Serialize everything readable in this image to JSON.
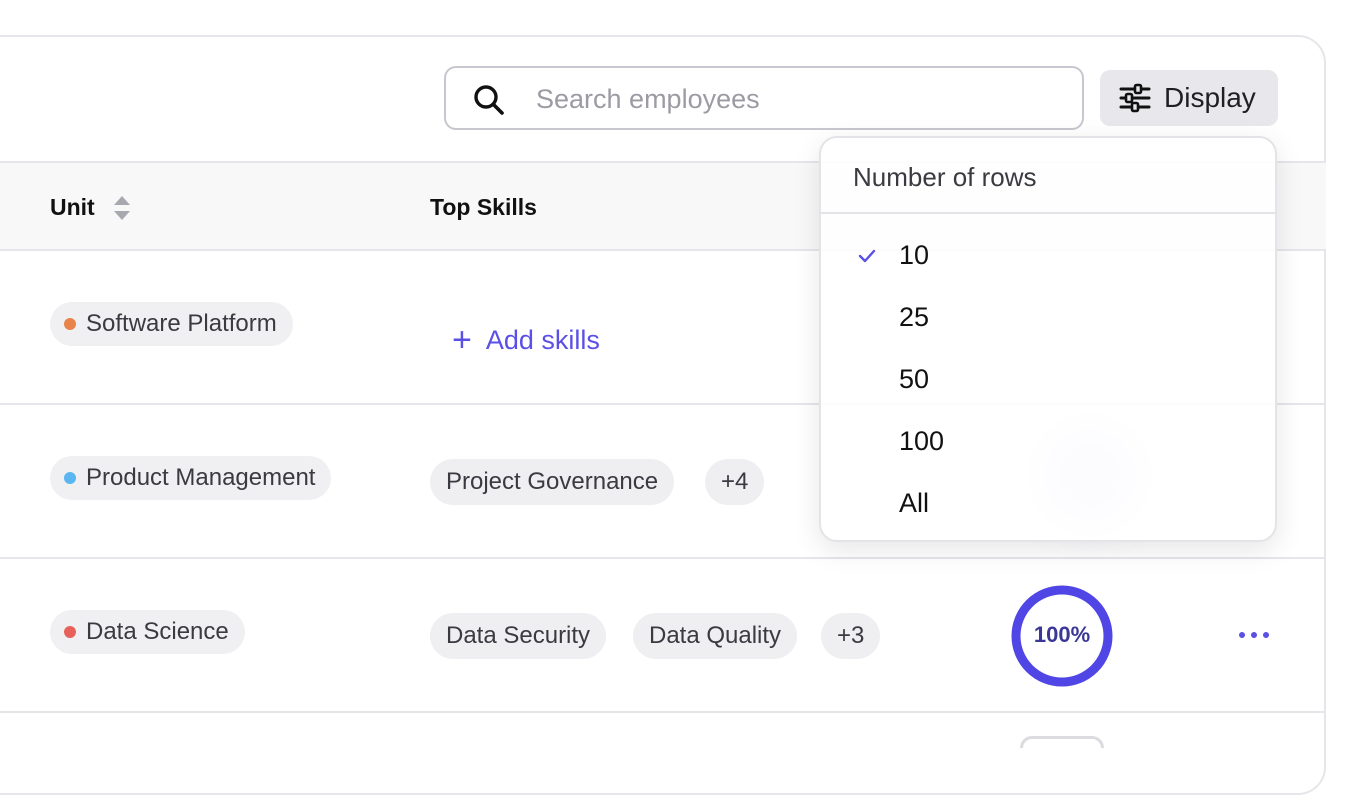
{
  "search": {
    "placeholder": "Search employees",
    "value": ""
  },
  "toolbar": {
    "display_label": "Display"
  },
  "table": {
    "columns": [
      "Unit",
      "Top Skills"
    ],
    "rows": [
      {
        "unit": "Software Platform",
        "unit_color": "#e8844a",
        "add_skills_label": "Add skills"
      },
      {
        "unit": "Product Management",
        "unit_color": "#5ab6f0",
        "skills": [
          "Project Governance"
        ],
        "more": "+4"
      },
      {
        "unit": "Data Science",
        "unit_color": "#e8605a",
        "skills": [
          "Data Security",
          "Data Quality"
        ],
        "more": "+3",
        "completion": "100%",
        "completion_value": 1.0
      }
    ]
  },
  "rows_menu": {
    "title": "Number of rows",
    "options": [
      "10",
      "25",
      "50",
      "100",
      "All"
    ],
    "selected": "10"
  },
  "colors": {
    "accent": "#5b50e6",
    "ring": "#4f46e5"
  }
}
